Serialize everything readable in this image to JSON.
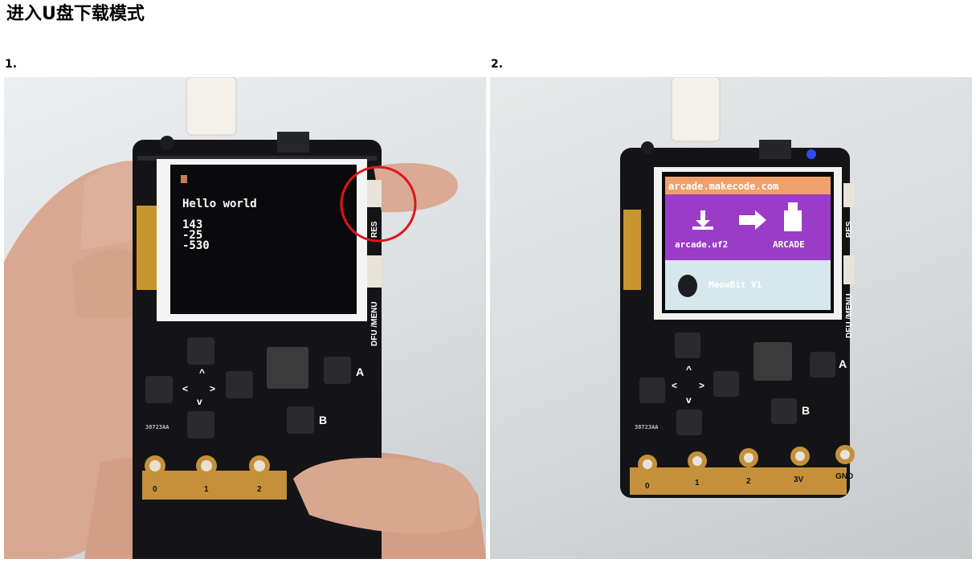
{
  "title": "进入U盘下载模式",
  "steps": [
    {
      "label": "1.",
      "screen": {
        "lines": [
          "Hello world",
          "143",
          "-25",
          "-530"
        ]
      },
      "board": {
        "side_labels": [
          "RES",
          "DFU /MENU"
        ],
        "button_labels": [
          "A",
          "B"
        ],
        "dpad_arrows": [
          "^",
          "<",
          ">",
          "v"
        ],
        "pins": [
          "0",
          "1",
          "2"
        ],
        "silkscreen": "38723AA"
      },
      "highlight_color": "#e0141b"
    },
    {
      "label": "2.",
      "screen": {
        "url": "arcade.makecode.com",
        "file": "arcade.uf2",
        "drive": "ARCADE",
        "device": "MeowBit V1",
        "banner_color": "#f0a06a",
        "panel_color": "#9b3cc8",
        "footer_color": "#d6e8ee"
      },
      "board": {
        "side_labels": [
          "RES",
          "DFU /MENU"
        ],
        "button_labels": [
          "A",
          "B"
        ],
        "dpad_arrows": [
          "^",
          "<",
          ">",
          "v"
        ],
        "pins": [
          "0",
          "1",
          "2",
          "3V",
          "GND"
        ],
        "silkscreen": "38723AA"
      },
      "led_color": "#2b4dff"
    }
  ]
}
